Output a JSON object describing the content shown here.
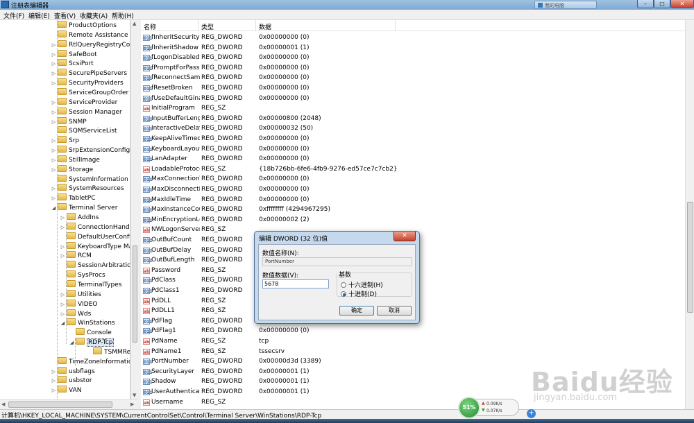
{
  "window": {
    "title": "注册表编辑器",
    "taskbar_item": "我的电脑",
    "controls": {
      "minimize": "–",
      "maximize": "□",
      "close": "✕"
    }
  },
  "menu": [
    "文件(F)",
    "编辑(E)",
    "查看(V)",
    "收藏夹(A)",
    "帮助(H)"
  ],
  "tree": {
    "items": [
      {
        "label": "ProductOptions",
        "level": 0,
        "arrow": ""
      },
      {
        "label": "Remote Assistance",
        "level": 0,
        "arrow": ""
      },
      {
        "label": "RtlQueryRegistryConfig",
        "level": 0,
        "arrow": "▷"
      },
      {
        "label": "SafeBoot",
        "level": 0,
        "arrow": "▷"
      },
      {
        "label": "ScsiPort",
        "level": 0,
        "arrow": "▷"
      },
      {
        "label": "SecurePipeServers",
        "level": 0,
        "arrow": "▷"
      },
      {
        "label": "SecurityProviders",
        "level": 0,
        "arrow": "▷"
      },
      {
        "label": "ServiceGroupOrder",
        "level": 0,
        "arrow": ""
      },
      {
        "label": "ServiceProvider",
        "level": 0,
        "arrow": "▷"
      },
      {
        "label": "Session Manager",
        "level": 0,
        "arrow": "▷"
      },
      {
        "label": "SNMP",
        "level": 0,
        "arrow": "▷"
      },
      {
        "label": "SQMServiceList",
        "level": 0,
        "arrow": ""
      },
      {
        "label": "Srp",
        "level": 0,
        "arrow": "▷"
      },
      {
        "label": "SrpExtensionConfig",
        "level": 0,
        "arrow": "▷"
      },
      {
        "label": "StillImage",
        "level": 0,
        "arrow": "▷"
      },
      {
        "label": "Storage",
        "level": 0,
        "arrow": "▷"
      },
      {
        "label": "SystemInformation",
        "level": 0,
        "arrow": ""
      },
      {
        "label": "SystemResources",
        "level": 0,
        "arrow": "▷"
      },
      {
        "label": "TabletPC",
        "level": 0,
        "arrow": "▷"
      },
      {
        "label": "Terminal Server",
        "level": 0,
        "arrow": "◢"
      },
      {
        "label": "AddIns",
        "level": 1,
        "arrow": "▷"
      },
      {
        "label": "ConnectionHandler",
        "level": 1,
        "arrow": "▷"
      },
      {
        "label": "DefaultUserConfiguration",
        "level": 1,
        "arrow": ""
      },
      {
        "label": "KeyboardType Mapping",
        "level": 1,
        "arrow": "▷"
      },
      {
        "label": "RCM",
        "level": 1,
        "arrow": "▷"
      },
      {
        "label": "SessionArbitrationHelper",
        "level": 1,
        "arrow": ""
      },
      {
        "label": "SysProcs",
        "level": 1,
        "arrow": ""
      },
      {
        "label": "TerminalTypes",
        "level": 1,
        "arrow": ""
      },
      {
        "label": "Utilities",
        "level": 1,
        "arrow": "▷"
      },
      {
        "label": "VIDEO",
        "level": 1,
        "arrow": "▷"
      },
      {
        "label": "Wds",
        "level": 1,
        "arrow": "▷"
      },
      {
        "label": "WinStations",
        "level": 1,
        "arrow": "◢"
      },
      {
        "label": "Console",
        "level": 2,
        "arrow": ""
      },
      {
        "label": "RDP-Tcp",
        "level": 2,
        "arrow": "◢",
        "selected": true
      },
      {
        "label": "TSMMRemotingAllowedApps",
        "level": 3,
        "arrow": ""
      },
      {
        "label": "TimeZoneInformation",
        "level": 0,
        "arrow": ""
      },
      {
        "label": "usbflags",
        "level": 0,
        "arrow": "▷"
      },
      {
        "label": "usbstor",
        "level": 0,
        "arrow": "▷"
      },
      {
        "label": "VAN",
        "level": 0,
        "arrow": "▷"
      }
    ]
  },
  "list": {
    "headers": {
      "name": "名称",
      "type": "类型",
      "data": "数据"
    },
    "rows": [
      {
        "icon": "dword",
        "name": "fInheritSecurity",
        "type": "REG_DWORD",
        "data": "0x00000000 (0)"
      },
      {
        "icon": "dword",
        "name": "fInheritShadow",
        "type": "REG_DWORD",
        "data": "0x00000001 (1)"
      },
      {
        "icon": "dword",
        "name": "fLogonDisabled",
        "type": "REG_DWORD",
        "data": "0x00000000 (0)"
      },
      {
        "icon": "dword",
        "name": "fPromptForPassword",
        "type": "REG_DWORD",
        "data": "0x00000000 (0)"
      },
      {
        "icon": "dword",
        "name": "fReconnectSame",
        "type": "REG_DWORD",
        "data": "0x00000000 (0)"
      },
      {
        "icon": "dword",
        "name": "fResetBroken",
        "type": "REG_DWORD",
        "data": "0x00000000 (0)"
      },
      {
        "icon": "dword",
        "name": "fUseDefaultGina",
        "type": "REG_DWORD",
        "data": "0x00000000 (0)"
      },
      {
        "icon": "sz",
        "name": "InitialProgram",
        "type": "REG_SZ",
        "data": ""
      },
      {
        "icon": "dword",
        "name": "InputBufferLength",
        "type": "REG_DWORD",
        "data": "0x00000800 (2048)"
      },
      {
        "icon": "dword",
        "name": "InteractiveDelay",
        "type": "REG_DWORD",
        "data": "0x00000032 (50)"
      },
      {
        "icon": "dword",
        "name": "KeepAliveTimeout",
        "type": "REG_DWORD",
        "data": "0x00000000 (0)"
      },
      {
        "icon": "dword",
        "name": "KeyboardLayout",
        "type": "REG_DWORD",
        "data": "0x00000000 (0)"
      },
      {
        "icon": "dword",
        "name": "LanAdapter",
        "type": "REG_DWORD",
        "data": "0x00000000 (0)"
      },
      {
        "icon": "sz",
        "name": "LoadableProtocol_Object",
        "type": "REG_SZ",
        "data": "{18b726bb-6fe6-4fb9-9276-ed57ce7c7cb2}"
      },
      {
        "icon": "dword",
        "name": "MaxConnectionTime",
        "type": "REG_DWORD",
        "data": "0x00000000 (0)"
      },
      {
        "icon": "dword",
        "name": "MaxDisconnectionTime",
        "type": "REG_DWORD",
        "data": "0x00000000 (0)"
      },
      {
        "icon": "dword",
        "name": "MaxIdleTime",
        "type": "REG_DWORD",
        "data": "0x00000000 (0)"
      },
      {
        "icon": "dword",
        "name": "MaxInstanceCount",
        "type": "REG_DWORD",
        "data": "0xffffffff (4294967295)"
      },
      {
        "icon": "dword",
        "name": "MinEncryptionLevel",
        "type": "REG_DWORD",
        "data": "0x00000002 (2)"
      },
      {
        "icon": "sz",
        "name": "NWLogonServer",
        "type": "REG_SZ",
        "data": ""
      },
      {
        "icon": "dword",
        "name": "OutBufCount",
        "type": "REG_DWORD",
        "data": ""
      },
      {
        "icon": "dword",
        "name": "OutBufDelay",
        "type": "REG_DWORD",
        "data": ""
      },
      {
        "icon": "dword",
        "name": "OutBufLength",
        "type": "REG_DWORD",
        "data": ""
      },
      {
        "icon": "sz",
        "name": "Password",
        "type": "REG_SZ",
        "data": ""
      },
      {
        "icon": "dword",
        "name": "PdClass",
        "type": "REG_DWORD",
        "data": ""
      },
      {
        "icon": "dword",
        "name": "PdClass1",
        "type": "REG_DWORD",
        "data": ""
      },
      {
        "icon": "sz",
        "name": "PdDLL",
        "type": "REG_SZ",
        "data": ""
      },
      {
        "icon": "sz",
        "name": "PdDLL1",
        "type": "REG_SZ",
        "data": ""
      },
      {
        "icon": "dword",
        "name": "PdFlag",
        "type": "REG_DWORD",
        "data": ""
      },
      {
        "icon": "dword",
        "name": "PdFlag1",
        "type": "REG_DWORD",
        "data": "0x00000000 (0)"
      },
      {
        "icon": "sz",
        "name": "PdName",
        "type": "REG_SZ",
        "data": "tcp"
      },
      {
        "icon": "sz",
        "name": "PdName1",
        "type": "REG_SZ",
        "data": "tssecsrv"
      },
      {
        "icon": "dword",
        "name": "PortNumber",
        "type": "REG_DWORD",
        "data": "0x00000d3d (3389)",
        "selected": true
      },
      {
        "icon": "dword",
        "name": "SecurityLayer",
        "type": "REG_DWORD",
        "data": "0x00000001 (1)"
      },
      {
        "icon": "dword",
        "name": "Shadow",
        "type": "REG_DWORD",
        "data": "0x00000001 (1)"
      },
      {
        "icon": "dword",
        "name": "UserAuthentication",
        "type": "REG_DWORD",
        "data": "0x00000001 (1)"
      },
      {
        "icon": "sz",
        "name": "Username",
        "type": "REG_SZ",
        "data": ""
      }
    ]
  },
  "status": {
    "path": "计算机\\HKEY_LOCAL_MACHINE\\SYSTEM\\CurrentControlSet\\Control\\Terminal Server\\WinStations\\RDP-Tcp"
  },
  "dialog": {
    "title": "编辑 DWORD (32 位)值",
    "close_label": "✕",
    "value_name_label": "数值名称(N):",
    "value_name": "PortNumber",
    "value_data_label": "数值数据(V):",
    "value_data": "5678",
    "base_label": "基数",
    "radio_hex": "十六进制(H)",
    "radio_dec": "十进制(D)",
    "selected_base": "decimal",
    "ok_label": "确定",
    "cancel_label": "取消"
  },
  "netmeter": {
    "percent": "51%",
    "up": "0.09K/s",
    "down": "0.07K/s",
    "plus": "+"
  },
  "watermark": {
    "logo": "Baidu经验",
    "url": "jingyan.baidu.com"
  }
}
